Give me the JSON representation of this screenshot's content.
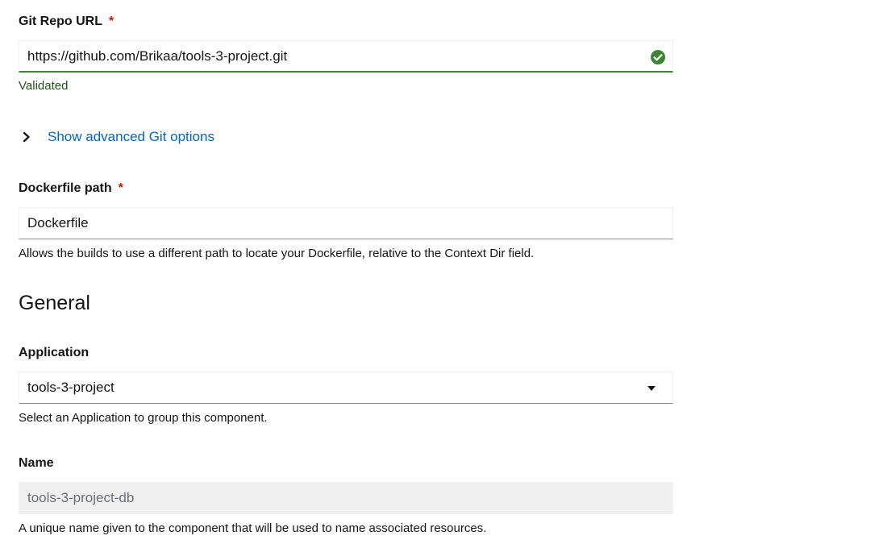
{
  "git": {
    "repo_label": "Git Repo URL",
    "required_mark": "*",
    "repo_value": "https://github.com/Brikaa/tools-3-project.git",
    "validated_text": "Validated",
    "advanced_toggle": "Show advanced Git options"
  },
  "dockerfile": {
    "label": "Dockerfile path",
    "required_mark": "*",
    "value": "Dockerfile",
    "helper": "Allows the builds to use a different path to locate your Dockerfile, relative to the Context Dir field."
  },
  "general": {
    "heading": "General",
    "application_label": "Application",
    "application_value": "tools-3-project",
    "application_helper": "Select an Application to group this component.",
    "name_label": "Name",
    "name_value": "tools-3-project-db",
    "name_helper": "A unique name given to the component that will be used to name associated resources."
  },
  "icons": {
    "validated": "check-circle-icon",
    "toggle": "chevron-right-icon",
    "dropdown": "caret-down-icon"
  },
  "colors": {
    "success": "#3e8635",
    "link": "#0066cc",
    "required": "#c9190b"
  }
}
